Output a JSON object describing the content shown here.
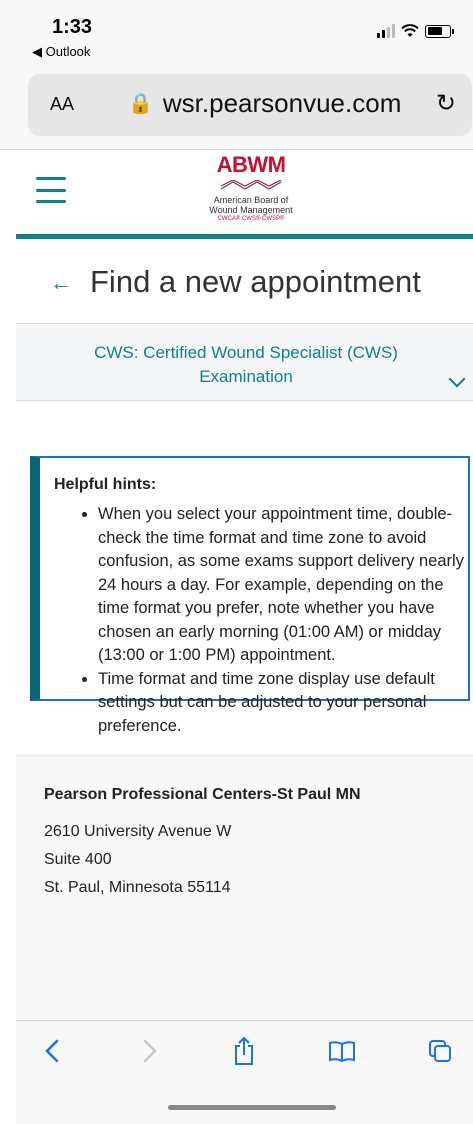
{
  "status_bar": {
    "time": "1:33",
    "back_app": "◀ Outlook"
  },
  "browser": {
    "aa_label": "AA",
    "url": "wsr.pearsonvue.com"
  },
  "site": {
    "logo_mark": "ABWM",
    "logo_name_line1": "American Board of",
    "logo_name_line2": "Wound Management",
    "logo_tagline": "CWCA® CWS® CWSP®"
  },
  "page": {
    "title": "Find a new appointment",
    "exam_line1": "CWS: Certified Wound Specialist (CWS)",
    "exam_line2": "Examination"
  },
  "hints": {
    "title": "Helpful hints:",
    "items": [
      "When you select your appointment time, double-check the time format and time zone to avoid confusion, as some exams support delivery nearly 24 hours a day. For example, depending on the time format you prefer, note whether you have chosen an early morning (01:00 AM) or midday (13:00 or 1:00 PM) appointment.",
      "Time format and time zone display use default settings but can be adjusted to your personal preference."
    ]
  },
  "location": {
    "name": "Pearson Professional Centers-St Paul MN",
    "address_line1": "2610 University Avenue W",
    "address_line2": "Suite 400",
    "address_line3": "St. Paul, Minnesota 55114"
  },
  "colors": {
    "accent": "#117f8c",
    "hint_border": "#1f6fd0",
    "logo_red": "#c8102e"
  },
  "icons": {
    "reload": "reload-icon",
    "back": "chevron-left-icon",
    "forward": "chevron-right-icon",
    "share": "share-icon",
    "bookmarks": "book-icon",
    "tabs": "tabs-icon"
  }
}
